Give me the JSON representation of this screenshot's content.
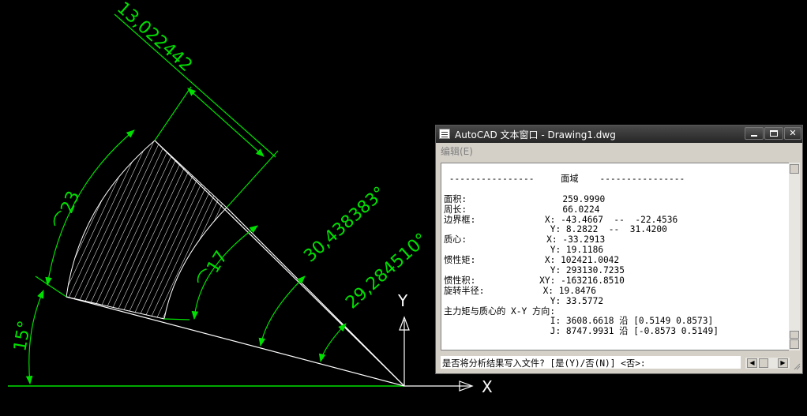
{
  "drawing": {
    "dimensions": {
      "width_dim": "13,022442",
      "angle_main": "30,438383°",
      "angle_inner": "29,284510°",
      "angle_base": "15°",
      "arc_outer": "⌒23",
      "arc_inner": "⌒17"
    },
    "axes": {
      "x_label": "X",
      "y_label": "Y"
    },
    "colors": {
      "dimension": "#00e000",
      "geometry": "#ffffff",
      "background": "#000000"
    }
  },
  "text_window": {
    "title": "AutoCAD 文本窗口 - Drawing1.dwg",
    "menu": {
      "edit": "编辑(E)"
    },
    "lines": [
      " ----------------     面域    ----------------",
      "",
      "面积:                  259.9990",
      "周长:                  66.0224",
      "边界框:             X: -43.4667  --  -22.4536",
      "                    Y: 8.2822  --  31.4200",
      "质心:               X: -33.2913",
      "                    Y: 19.1186",
      "惯性矩:             X: 102421.0042",
      "                    Y: 293130.7235",
      "惯性积:            XY: -163216.8510",
      "旋转半径:           X: 19.8476",
      "                    Y: 33.5772",
      "主力矩与质心的 X-Y 方向:",
      "                    I: 3608.6618 沿 [0.5149 0.8573]",
      "                    J: 8747.9931 沿 [-0.8573 0.5149]"
    ],
    "command_prompt": "是否将分析结果写入文件? [是(Y)/否(N)] <否>:"
  }
}
